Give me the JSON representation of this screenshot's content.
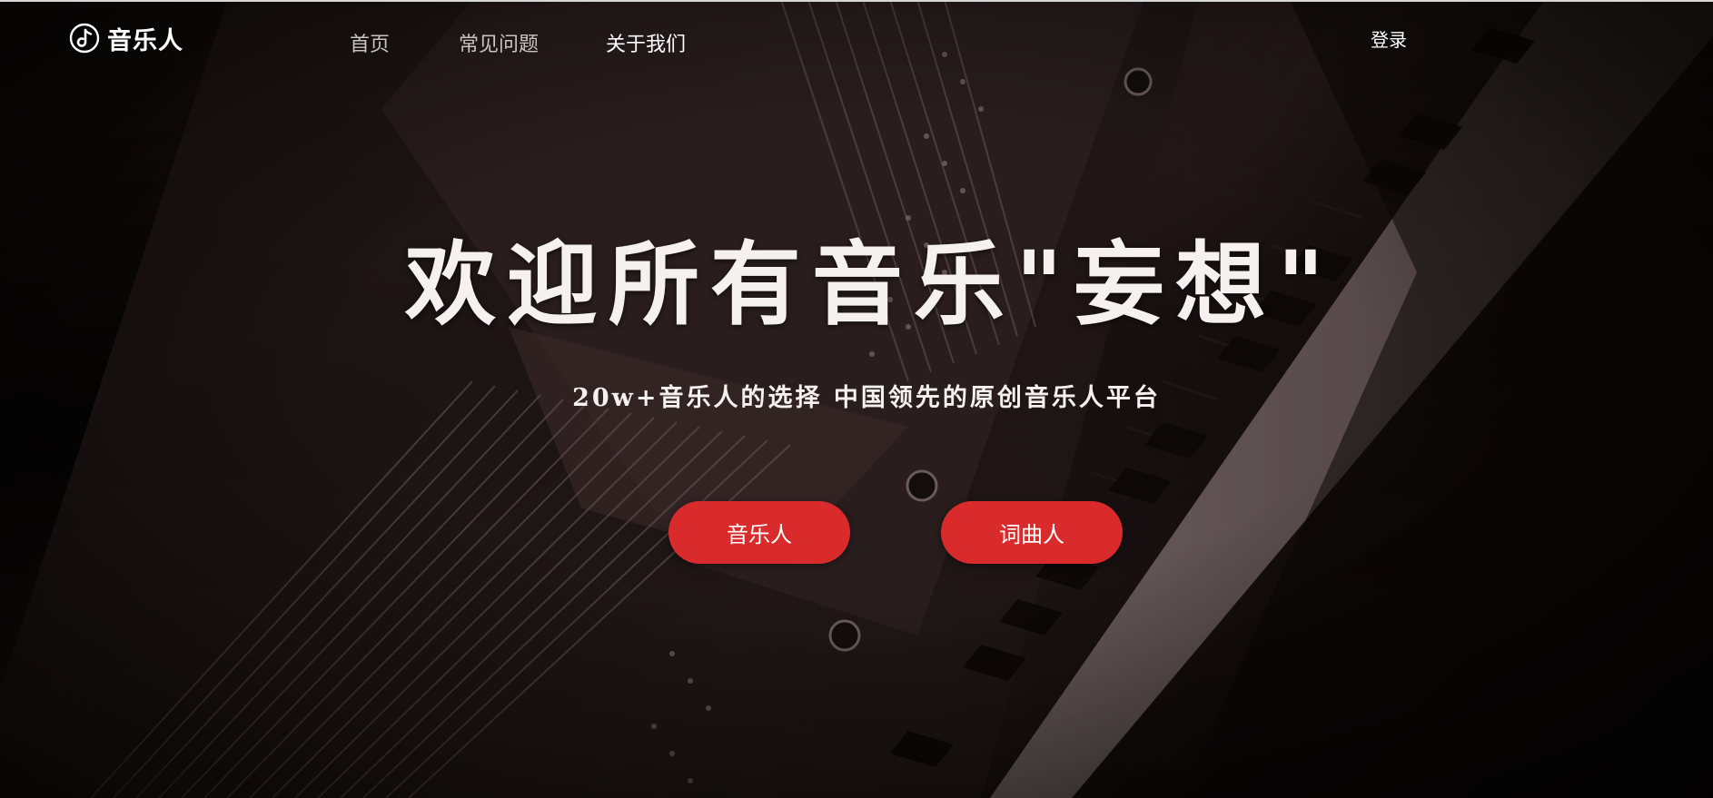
{
  "header": {
    "logo_text": "音乐人",
    "logo_icon": "music-note-circle-icon",
    "nav": [
      {
        "label": "首页",
        "active": false
      },
      {
        "label": "常见问题",
        "active": false
      },
      {
        "label": "关于我们",
        "active": true
      }
    ],
    "login_label": "登录"
  },
  "hero": {
    "title": "欢迎所有音乐\"妄想\"",
    "subtitle": "20w+音乐人的选择 中国领先的原创音乐人平台",
    "buttons": [
      {
        "label": "音乐人"
      },
      {
        "label": "词曲人"
      }
    ]
  },
  "colors": {
    "accent": "#d92b2b",
    "text": "#ffffff",
    "nav_inactive": "#c9c4c4",
    "background": "#1a1111"
  },
  "background_image": "piano-interior"
}
